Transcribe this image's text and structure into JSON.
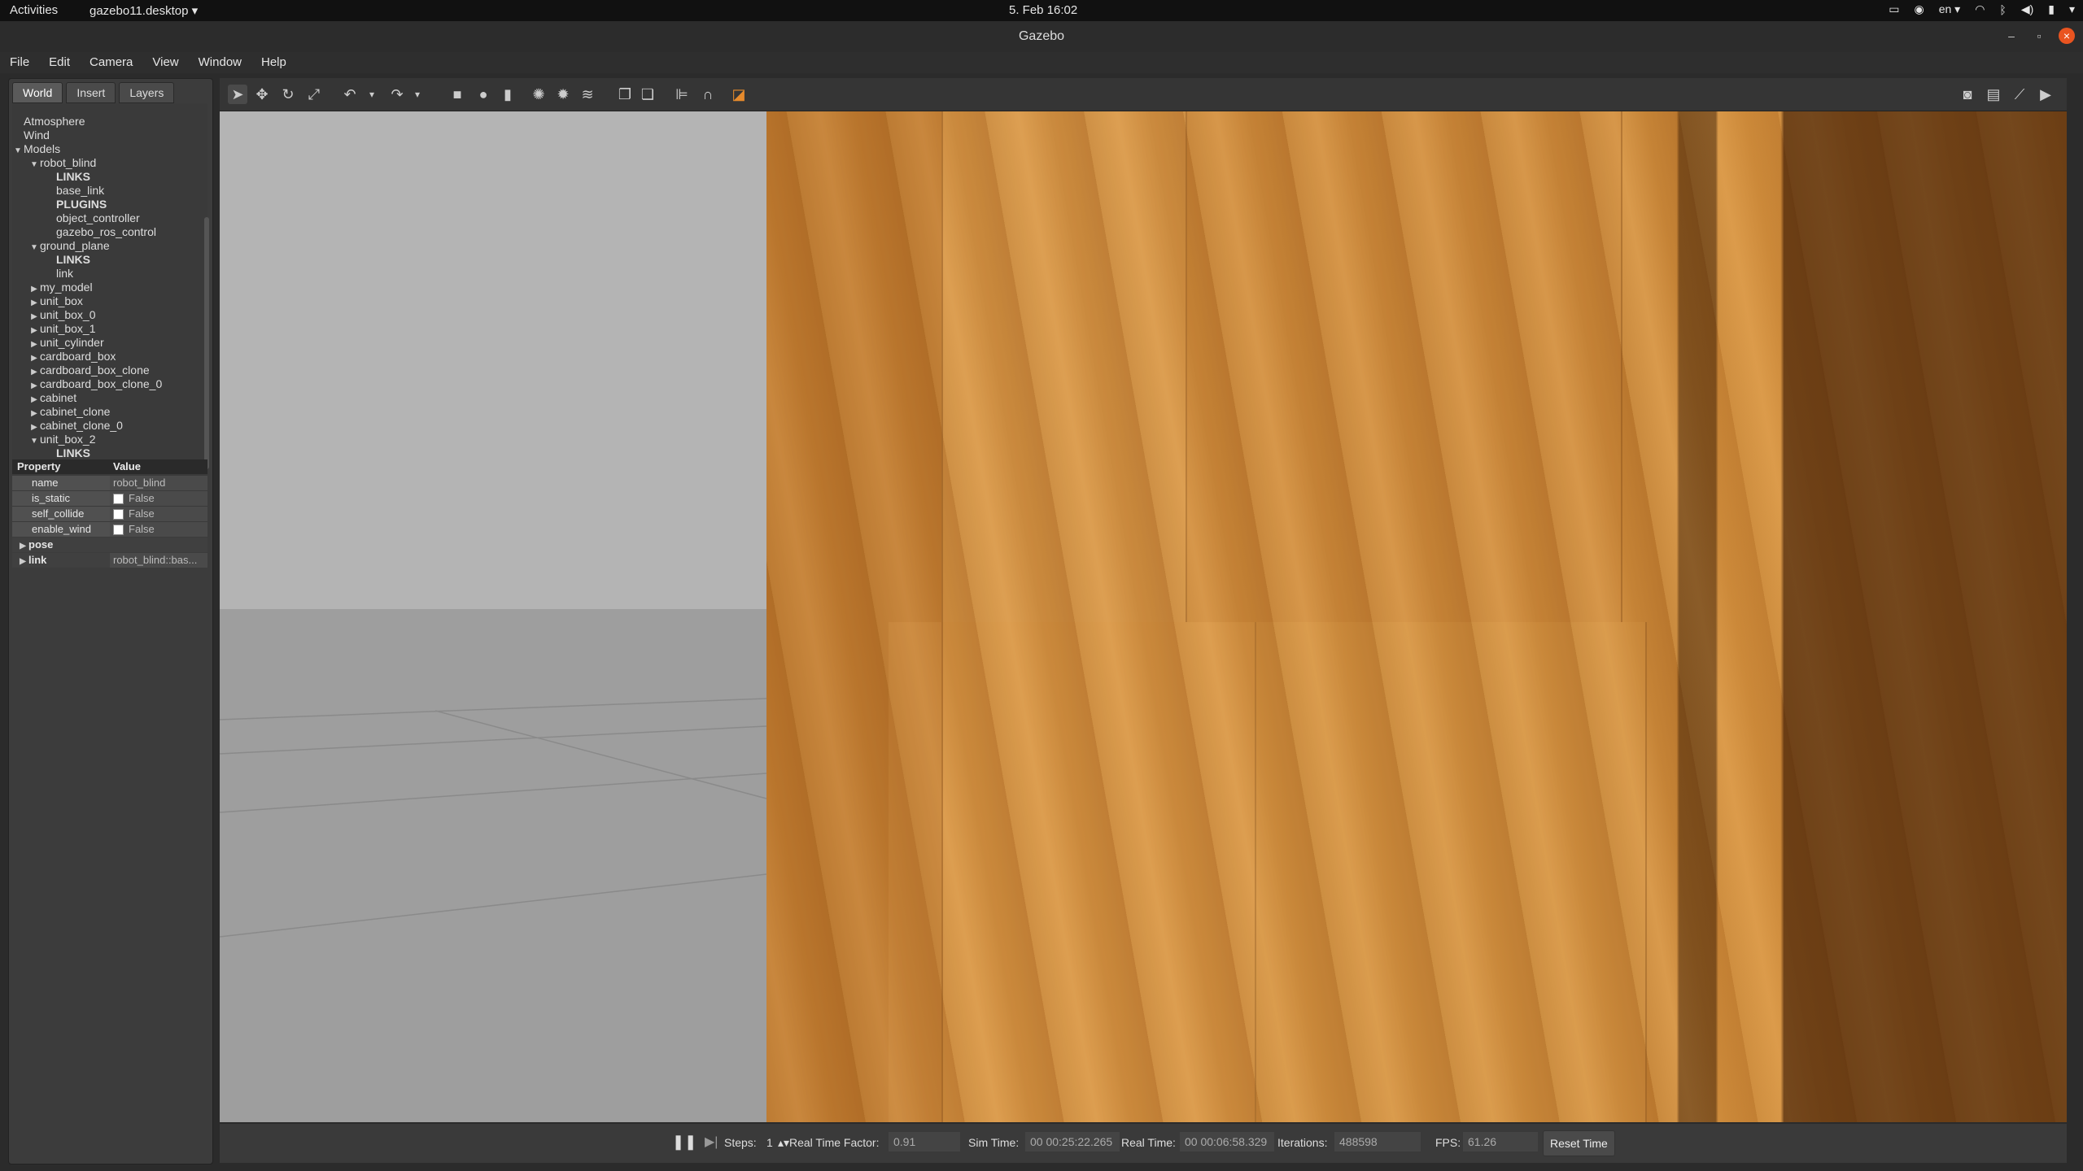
{
  "topbar": {
    "activities": "Activities",
    "app_menu": "gazebo11.desktop ▾",
    "clock": "5. Feb  16:02",
    "lang": "en ▾"
  },
  "window": {
    "title": "Gazebo"
  },
  "menu": [
    "File",
    "Edit",
    "Camera",
    "View",
    "Window",
    "Help"
  ],
  "tabs": [
    "World",
    "Insert",
    "Layers"
  ],
  "tree": [
    {
      "label": "Atmosphere",
      "indent": 0,
      "arrow": "",
      "bold": false
    },
    {
      "label": "Wind",
      "indent": 0,
      "arrow": "",
      "bold": false
    },
    {
      "label": "Models",
      "indent": 0,
      "arrow": "▼",
      "bold": false
    },
    {
      "label": "robot_blind",
      "indent": 1,
      "arrow": "▼",
      "bold": false
    },
    {
      "label": "LINKS",
      "indent": 2,
      "arrow": "",
      "bold": true
    },
    {
      "label": "base_link",
      "indent": 2,
      "arrow": "",
      "bold": false
    },
    {
      "label": "PLUGINS",
      "indent": 2,
      "arrow": "",
      "bold": true
    },
    {
      "label": "object_controller",
      "indent": 2,
      "arrow": "",
      "bold": false
    },
    {
      "label": "gazebo_ros_control",
      "indent": 2,
      "arrow": "",
      "bold": false
    },
    {
      "label": "ground_plane",
      "indent": 1,
      "arrow": "▼",
      "bold": false
    },
    {
      "label": "LINKS",
      "indent": 2,
      "arrow": "",
      "bold": true
    },
    {
      "label": "link",
      "indent": 2,
      "arrow": "",
      "bold": false
    },
    {
      "label": "my_model",
      "indent": 1,
      "arrow": "▶",
      "bold": false
    },
    {
      "label": "unit_box",
      "indent": 1,
      "arrow": "▶",
      "bold": false
    },
    {
      "label": "unit_box_0",
      "indent": 1,
      "arrow": "▶",
      "bold": false
    },
    {
      "label": "unit_box_1",
      "indent": 1,
      "arrow": "▶",
      "bold": false
    },
    {
      "label": "unit_cylinder",
      "indent": 1,
      "arrow": "▶",
      "bold": false
    },
    {
      "label": "cardboard_box",
      "indent": 1,
      "arrow": "▶",
      "bold": false
    },
    {
      "label": "cardboard_box_clone",
      "indent": 1,
      "arrow": "▶",
      "bold": false
    },
    {
      "label": "cardboard_box_clone_0",
      "indent": 1,
      "arrow": "▶",
      "bold": false
    },
    {
      "label": "cabinet",
      "indent": 1,
      "arrow": "▶",
      "bold": false
    },
    {
      "label": "cabinet_clone",
      "indent": 1,
      "arrow": "▶",
      "bold": false
    },
    {
      "label": "cabinet_clone_0",
      "indent": 1,
      "arrow": "▶",
      "bold": false
    },
    {
      "label": "unit_box_2",
      "indent": 1,
      "arrow": "▼",
      "bold": false
    },
    {
      "label": "LINKS",
      "indent": 2,
      "arrow": "",
      "bold": true
    }
  ],
  "props": {
    "header": {
      "property": "Property",
      "value": "Value"
    },
    "rows": [
      {
        "key": "name",
        "value": "robot_blind",
        "checkbox": false,
        "arrow": ""
      },
      {
        "key": "is_static",
        "value": "False",
        "checkbox": true,
        "arrow": ""
      },
      {
        "key": "self_collide",
        "value": "False",
        "checkbox": true,
        "arrow": ""
      },
      {
        "key": "enable_wind",
        "value": "False",
        "checkbox": true,
        "arrow": ""
      },
      {
        "key": "pose",
        "value": "",
        "checkbox": false,
        "arrow": "▶"
      },
      {
        "key": "link",
        "value": "robot_blind::bas...",
        "checkbox": false,
        "arrow": "▶"
      }
    ]
  },
  "toolbar_icons": [
    "select-arrow-icon",
    "translate-icon",
    "rotate-icon",
    "scale-icon",
    "undo-icon",
    "undo-dropdown-icon",
    "redo-icon",
    "redo-dropdown-icon",
    "box-icon",
    "sphere-icon",
    "cylinder-icon",
    "point-light-icon",
    "spot-light-icon",
    "directional-light-icon",
    "copy-icon",
    "paste-icon",
    "align-icon",
    "snap-icon",
    "view-angle-icon"
  ],
  "toolbar_right_icons": [
    "screenshot-icon",
    "log-icon",
    "plot-icon",
    "record-icon"
  ],
  "status": {
    "steps_label": "Steps:",
    "steps_value": "1",
    "rtf_label": "Real Time Factor:",
    "rtf_value": "0.91",
    "sim_label": "Sim Time:",
    "sim_value": "00 00:25:22.265",
    "real_label": "Real Time:",
    "real_value": "00 00:06:58.329",
    "iter_label": "Iterations:",
    "iter_value": "488598",
    "fps_label": "FPS:",
    "fps_value": "61.26",
    "reset_label": "Reset Time"
  }
}
